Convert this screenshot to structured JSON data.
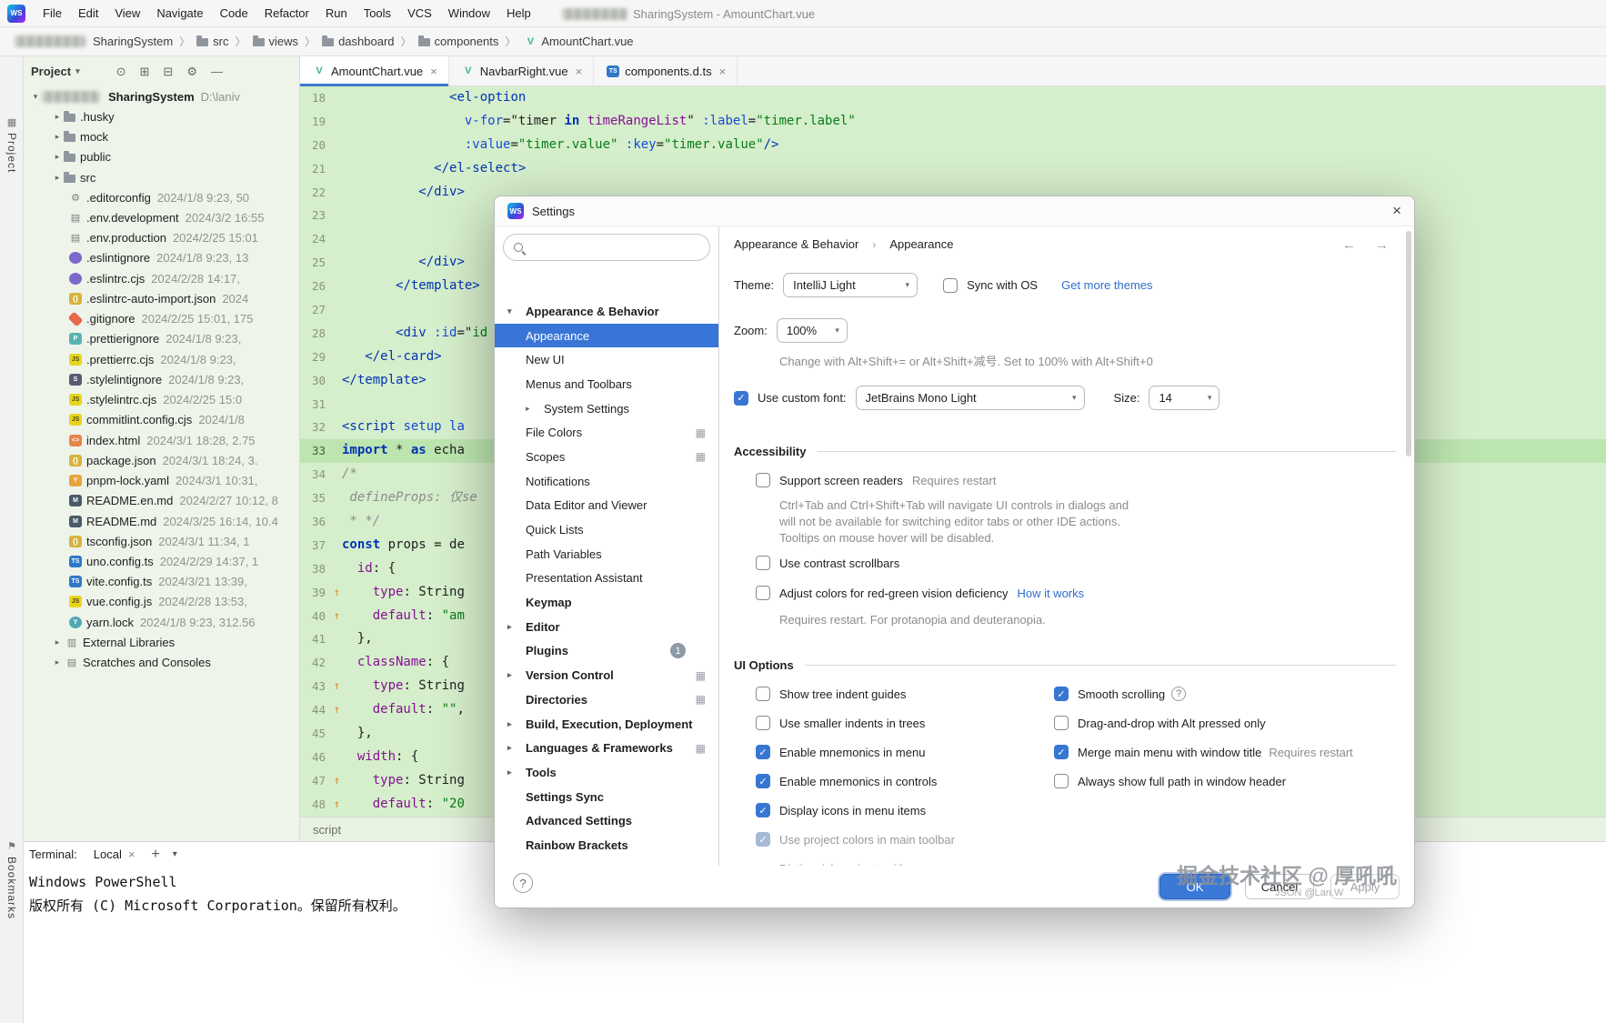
{
  "accents": {
    "accent_blue": "#3876d3",
    "selection_blue": "#3875d6",
    "link_blue": "#2e6fd0",
    "editor_green": "#d5eecb",
    "current_line_green": "#bde5b0"
  },
  "watermark": {
    "line1": "掘金技术社区 @ 厚吼吼",
    "line2": "JSON @Lan.W"
  },
  "title_bar": {
    "title": "SharingSystem - AmountChart.vue",
    "menus": [
      "File",
      "Edit",
      "View",
      "Navigate",
      "Code",
      "Refactor",
      "Run",
      "Tools",
      "VCS",
      "Window",
      "Help"
    ]
  },
  "breadcrumbs": [
    "SharingSystem",
    "src",
    "views",
    "dashboard",
    "components",
    "AmountChart.vue"
  ],
  "left_strip": {
    "top": "Project",
    "bottom": "Bookmarks"
  },
  "project": {
    "header": "Project",
    "root": {
      "name": "SharingSystem",
      "path": "D:\\laniv"
    },
    "items": [
      {
        "name": ".husky",
        "icon": "folder",
        "kind": "folder"
      },
      {
        "name": "mock",
        "icon": "folder",
        "kind": "folder"
      },
      {
        "name": "public",
        "icon": "folder",
        "kind": "folder"
      },
      {
        "name": "src",
        "icon": "folder",
        "kind": "folder"
      },
      {
        "name": ".editorconfig",
        "meta": "2024/1/8 9:23, 50",
        "icon": "editorconfig"
      },
      {
        "name": ".env.development",
        "meta": "2024/3/2 16:55",
        "icon": "env"
      },
      {
        "name": ".env.production",
        "meta": "2024/2/25 15:01",
        "icon": "env"
      },
      {
        "name": ".eslintignore",
        "meta": "2024/1/8 9:23, 13",
        "icon": "eslint"
      },
      {
        "name": ".eslintrc.cjs",
        "meta": "2024/2/28 14:17,",
        "icon": "eslint"
      },
      {
        "name": ".eslintrc-auto-import.json",
        "meta": "2024",
        "icon": "json"
      },
      {
        "name": ".gitignore",
        "meta": "2024/2/25 15:01, 175",
        "icon": "git"
      },
      {
        "name": ".prettierignore",
        "meta": "2024/1/8 9:23,",
        "icon": "prettier"
      },
      {
        "name": ".prettierrc.cjs",
        "meta": "2024/1/8 9:23,",
        "icon": "js"
      },
      {
        "name": ".stylelintignore",
        "meta": "2024/1/8 9:23,",
        "icon": "stylelint"
      },
      {
        "name": ".stylelintrc.cjs",
        "meta": "2024/2/25 15:0",
        "icon": "js"
      },
      {
        "name": "commitlint.config.cjs",
        "meta": "2024/1/8",
        "icon": "js"
      },
      {
        "name": "index.html",
        "meta": "2024/3/1 18:28, 2.75",
        "icon": "html"
      },
      {
        "name": "package.json",
        "meta": "2024/3/1 18:24, 3.",
        "icon": "json"
      },
      {
        "name": "pnpm-lock.yaml",
        "meta": "2024/3/1 10:31,",
        "icon": "yaml"
      },
      {
        "name": "README.en.md",
        "meta": "2024/2/27 10:12, 8",
        "icon": "md"
      },
      {
        "name": "README.md",
        "meta": "2024/3/25 16:14, 10.4",
        "icon": "md"
      },
      {
        "name": "tsconfig.json",
        "meta": "2024/3/1 11:34, 1",
        "icon": "json"
      },
      {
        "name": "uno.config.ts",
        "meta": "2024/2/29 14:37, 1",
        "icon": "ts"
      },
      {
        "name": "vite.config.ts",
        "meta": "2024/3/21 13:39,",
        "icon": "ts"
      },
      {
        "name": "vue.config.js",
        "meta": "2024/2/28 13:53,",
        "icon": "js"
      },
      {
        "name": "yarn.lock",
        "meta": "2024/1/8 9:23, 312.56",
        "icon": "lock"
      },
      {
        "name": "External Libraries",
        "icon": "libraries",
        "kind": "special"
      },
      {
        "name": "Scratches and Consoles",
        "icon": "scratches",
        "kind": "special"
      }
    ]
  },
  "tabs": [
    {
      "label": "AmountChart.vue",
      "icon": "vue",
      "active": true
    },
    {
      "label": "NavbarRight.vue",
      "icon": "vue",
      "active": false
    },
    {
      "label": "components.d.ts",
      "icon": "ts",
      "active": false
    }
  ],
  "editor": {
    "breadcrumb": "script",
    "lines": [
      {
        "n": 18,
        "t": [
          [
            "n",
            "              "
          ],
          [
            "t",
            "<el-option"
          ]
        ]
      },
      {
        "n": 19,
        "t": [
          [
            "n",
            "                "
          ],
          [
            "a",
            "v-for"
          ],
          [
            "n",
            "=\""
          ],
          [
            "n",
            "timer "
          ],
          [
            "k",
            "in"
          ],
          [
            "p",
            " timeRangeList"
          ],
          [
            "n",
            "\" "
          ],
          [
            "a",
            ":label"
          ],
          [
            "n",
            "="
          ],
          [
            "s",
            "\"timer.label\""
          ]
        ]
      },
      {
        "n": 20,
        "t": [
          [
            "n",
            "                "
          ],
          [
            "a",
            ":value"
          ],
          [
            "n",
            "="
          ],
          [
            "s",
            "\"timer.value\""
          ],
          [
            "n",
            " "
          ],
          [
            "a",
            ":key"
          ],
          [
            "n",
            "="
          ],
          [
            "s",
            "\"timer.value\""
          ],
          [
            "t",
            "/>"
          ]
        ]
      },
      {
        "n": 21,
        "t": [
          [
            "n",
            "            "
          ],
          [
            "t",
            "</el-select>"
          ]
        ]
      },
      {
        "n": 22,
        "t": [
          [
            "n",
            "          "
          ],
          [
            "t",
            "</div>"
          ]
        ]
      },
      {
        "n": 23,
        "t": []
      },
      {
        "n": 24,
        "t": []
      },
      {
        "n": 25,
        "t": [
          [
            "n",
            "          "
          ],
          [
            "t",
            "</div>"
          ]
        ]
      },
      {
        "n": 26,
        "t": [
          [
            "n",
            "       "
          ],
          [
            "t",
            "</template>"
          ]
        ]
      },
      {
        "n": 27,
        "t": []
      },
      {
        "n": 28,
        "t": [
          [
            "n",
            "       "
          ],
          [
            "t",
            "<div"
          ],
          [
            "n",
            " "
          ],
          [
            "a",
            ":id"
          ],
          [
            "n",
            "=\""
          ],
          [
            "s",
            "id"
          ]
        ]
      },
      {
        "n": 29,
        "t": [
          [
            "n",
            "   "
          ],
          [
            "t",
            "</el-card>"
          ]
        ]
      },
      {
        "n": 30,
        "t": [
          [
            "t",
            "</template>"
          ]
        ]
      },
      {
        "n": 31,
        "t": []
      },
      {
        "n": 32,
        "t": [
          [
            "t",
            "<script"
          ],
          [
            "n",
            " "
          ],
          [
            "a",
            "setup"
          ],
          [
            "n",
            " "
          ],
          [
            "a",
            "la"
          ]
        ]
      },
      {
        "n": 33,
        "active": true,
        "t": [
          [
            "k",
            "import"
          ],
          [
            "n",
            " * "
          ],
          [
            "k",
            "as"
          ],
          [
            "n",
            " echa"
          ]
        ]
      },
      {
        "n": 34,
        "t": [
          [
            "c",
            "/*"
          ]
        ]
      },
      {
        "n": 35,
        "t": [
          [
            "c",
            " defineProps: 仅se"
          ]
        ]
      },
      {
        "n": 36,
        "t": [
          [
            "c",
            " * */"
          ]
        ]
      },
      {
        "n": 37,
        "t": [
          [
            "k",
            "const"
          ],
          [
            "n",
            " props = de"
          ]
        ]
      },
      {
        "n": 38,
        "t": [
          [
            "n",
            "  "
          ],
          [
            "p",
            "id"
          ],
          [
            "n",
            ": {"
          ]
        ]
      },
      {
        "n": 39,
        "mark": true,
        "t": [
          [
            "n",
            "    "
          ],
          [
            "p",
            "type"
          ],
          [
            "n",
            ": String"
          ]
        ]
      },
      {
        "n": 40,
        "mark": true,
        "t": [
          [
            "n",
            "    "
          ],
          [
            "p",
            "default"
          ],
          [
            "n",
            ": "
          ],
          [
            "s",
            "\"am"
          ]
        ]
      },
      {
        "n": 41,
        "t": [
          [
            "n",
            "  },"
          ]
        ]
      },
      {
        "n": 42,
        "t": [
          [
            "n",
            "  "
          ],
          [
            "p",
            "className"
          ],
          [
            "n",
            ": {"
          ]
        ]
      },
      {
        "n": 43,
        "mark": true,
        "t": [
          [
            "n",
            "    "
          ],
          [
            "p",
            "type"
          ],
          [
            "n",
            ": String"
          ]
        ]
      },
      {
        "n": 44,
        "mark": true,
        "t": [
          [
            "n",
            "    "
          ],
          [
            "p",
            "default"
          ],
          [
            "n",
            ": "
          ],
          [
            "s",
            "\"\""
          ],
          [
            "n",
            ","
          ]
        ]
      },
      {
        "n": 45,
        "t": [
          [
            "n",
            "  },"
          ]
        ]
      },
      {
        "n": 46,
        "t": [
          [
            "n",
            "  "
          ],
          [
            "p",
            "width"
          ],
          [
            "n",
            ": {"
          ]
        ]
      },
      {
        "n": 47,
        "mark": true,
        "t": [
          [
            "n",
            "    "
          ],
          [
            "p",
            "type"
          ],
          [
            "n",
            ": String"
          ]
        ]
      },
      {
        "n": 48,
        "mark": true,
        "t": [
          [
            "n",
            "    "
          ],
          [
            "p",
            "default"
          ],
          [
            "n",
            ": "
          ],
          [
            "s",
            "\"20"
          ]
        ]
      }
    ]
  },
  "terminal": {
    "label": "Terminal:",
    "tab": "Local",
    "lines": [
      "Windows PowerShell",
      "版权所有 (C)  Microsoft Corporation。保留所有权利。"
    ]
  },
  "settings": {
    "dialog_title": "Settings",
    "nav": [
      {
        "label": "Appearance & Behavior",
        "level": 0,
        "bold": true,
        "chevron": "down"
      },
      {
        "label": "Appearance",
        "level": 1,
        "selected": true
      },
      {
        "label": "New UI",
        "level": 1
      },
      {
        "label": "Menus and Toolbars",
        "level": 1
      },
      {
        "label": "System Settings",
        "level": 1,
        "chevron": "right"
      },
      {
        "label": "File Colors",
        "level": 1,
        "proj_icon": true
      },
      {
        "label": "Scopes",
        "level": 1,
        "proj_icon": true
      },
      {
        "label": "Notifications",
        "level": 1
      },
      {
        "label": "Data Editor and Viewer",
        "level": 1
      },
      {
        "label": "Quick Lists",
        "level": 1
      },
      {
        "label": "Path Variables",
        "level": 1
      },
      {
        "label": "Presentation Assistant",
        "level": 1
      },
      {
        "label": "Keymap",
        "level": 0,
        "bold": true
      },
      {
        "label": "Editor",
        "level": 0,
        "bold": true,
        "chevron": "right"
      },
      {
        "label": "Plugins",
        "level": 0,
        "bold": true,
        "badge": "1"
      },
      {
        "label": "Version Control",
        "level": 0,
        "bold": true,
        "chevron": "right",
        "proj_icon": true
      },
      {
        "label": "Directories",
        "level": 0,
        "bold": true,
        "proj_icon": true
      },
      {
        "label": "Build, Execution, Deployment",
        "level": 0,
        "bold": true,
        "chevron": "right"
      },
      {
        "label": "Languages & Frameworks",
        "level": 0,
        "bold": true,
        "chevron": "right",
        "proj_icon": true
      },
      {
        "label": "Tools",
        "level": 0,
        "bold": true,
        "chevron": "right"
      },
      {
        "label": "Settings Sync",
        "level": 0,
        "bold": true
      },
      {
        "label": "Advanced Settings",
        "level": 0,
        "bold": true
      },
      {
        "label": "Rainbow Brackets",
        "level": 0,
        "bold": true
      }
    ],
    "content": {
      "breadcrumb_parent": "Appearance & Behavior",
      "breadcrumb_sep": "›",
      "breadcrumb_current": "Appearance",
      "theme_label": "Theme:",
      "theme_value": "IntelliJ Light",
      "sync_with_os": "Sync with OS",
      "get_more_themes": "Get more themes",
      "zoom_label": "Zoom:",
      "zoom_value": "100%",
      "zoom_hint": "Change with Alt+Shift+= or Alt+Shift+减号. Set to 100% with Alt+Shift+0",
      "custom_font_label": "Use custom font:",
      "custom_font_value": "JetBrains Mono Light",
      "size_label": "Size:",
      "size_value": "14",
      "accessibility_title": "Accessibility",
      "screen_readers_label": "Support screen readers",
      "requires_restart": "Requires restart",
      "screen_readers_hint": [
        "Ctrl+Tab and Ctrl+Shift+Tab will navigate UI controls in dialogs and",
        "will not be available for switching editor tabs or other IDE actions.",
        "Tooltips on mouse hover will be disabled."
      ],
      "contrast_scrollbars_label": "Use contrast scrollbars",
      "adjust_colors_label": "Adjust colors for red-green vision deficiency",
      "how_it_works": "How it works",
      "adjust_colors_hint": "Requires restart. For protanopia and deuteranopia.",
      "ui_options_title": "UI Options",
      "ui_options_left": [
        {
          "label": "Show tree indent guides",
          "checked": false
        },
        {
          "label": "Use smaller indents in trees",
          "checked": false
        },
        {
          "label": "Enable mnemonics in menu",
          "checked": true
        },
        {
          "label": "Enable mnemonics in controls",
          "checked": true
        },
        {
          "label": "Display icons in menu items",
          "checked": true
        },
        {
          "label": "Use project colors in main toolbar",
          "checked": true,
          "disabled": true
        },
        {
          "label": "Distinguish projects with",
          "checked": false,
          "disabled": true,
          "no_checkbox": true
        }
      ],
      "ui_options_right": [
        {
          "label": "Smooth scrolling",
          "checked": true,
          "help": true
        },
        {
          "label": "Drag-and-drop with Alt pressed only",
          "checked": false
        },
        {
          "label": "Merge main menu with window title",
          "checked": true,
          "suffix": "Requires restart"
        },
        {
          "label": "Always show full path in window header",
          "checked": false
        }
      ],
      "buttons": {
        "ok": "OK",
        "cancel": "Cancel",
        "apply": "Apply"
      }
    }
  }
}
